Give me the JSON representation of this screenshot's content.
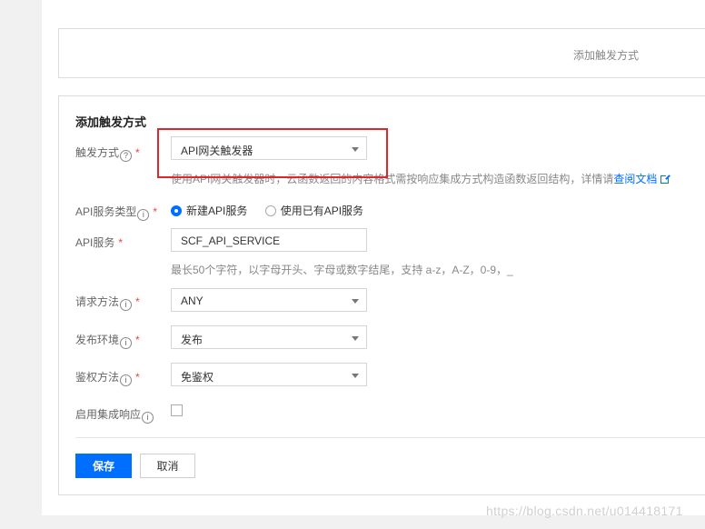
{
  "top_card": {
    "add_trigger_text": "添加触发方式"
  },
  "form": {
    "title": "添加触发方式",
    "trigger_type": {
      "label": "触发方式",
      "help_icon": "question-circle-icon",
      "required_mark": "*",
      "value": "API网关触发器"
    },
    "trigger_hint": {
      "text": "使用API网关触发器时，云函数返回的内容格式需按响应集成方式构造函数返回结构，详情请",
      "link": "查阅文档"
    },
    "api_service_type": {
      "label": "API服务类型",
      "required_mark": "*",
      "options": [
        "新建API服务",
        "使用已有API服务"
      ],
      "selected": "新建API服务"
    },
    "api_service": {
      "label": "API服务",
      "required_mark": "*",
      "value": "SCF_API_SERVICE",
      "hint": "最长50个字符，以字母开头、字母或数字结尾，支持 a-z，A-Z，0-9，_"
    },
    "request_method": {
      "label": "请求方法",
      "required_mark": "*",
      "value": "ANY"
    },
    "publish_env": {
      "label": "发布环境",
      "required_mark": "*",
      "value": "发布"
    },
    "auth_method": {
      "label": "鉴权方法",
      "required_mark": "*",
      "value": "免鉴权"
    },
    "integration_response": {
      "label": "启用集成响应",
      "checked": false
    },
    "buttons": {
      "save": "保存",
      "cancel": "取消"
    }
  },
  "watermark": "https://blog.csdn.net/u014418171",
  "colors": {
    "primary": "#006eff",
    "required": "#e54545",
    "highlight": "#e0262c"
  }
}
